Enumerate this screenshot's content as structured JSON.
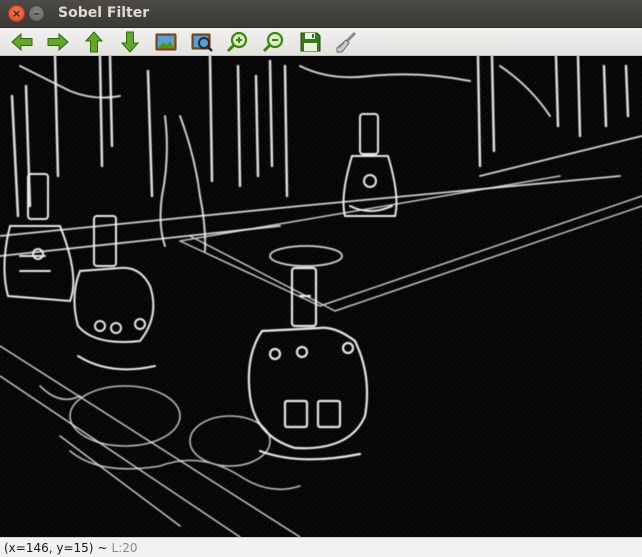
{
  "window": {
    "title": "Sobel Filter",
    "close_glyph": "×",
    "minimize_glyph": "–"
  },
  "toolbar": {
    "items": [
      {
        "name": "pan-left-button",
        "icon": "arrow-left-icon",
        "color": "#4e9a06"
      },
      {
        "name": "pan-right-button",
        "icon": "arrow-right-icon",
        "color": "#4e9a06"
      },
      {
        "name": "pan-up-button",
        "icon": "arrow-up-icon",
        "color": "#4e9a06"
      },
      {
        "name": "pan-down-button",
        "icon": "arrow-down-icon",
        "color": "#4e9a06"
      },
      {
        "name": "zoom-fit-button",
        "icon": "picture-icon"
      },
      {
        "name": "zoom-region-button",
        "icon": "picture-zoom-icon"
      },
      {
        "name": "zoom-in-button",
        "icon": "zoom-in-icon",
        "color": "#4e9a06"
      },
      {
        "name": "zoom-out-button",
        "icon": "zoom-out-icon",
        "color": "#4e9a06"
      },
      {
        "name": "save-button",
        "icon": "floppy-disk-icon",
        "color": "#3a7a16"
      },
      {
        "name": "properties-button",
        "icon": "brush-icon"
      }
    ]
  },
  "status": {
    "coords": "(x=146, y=15)",
    "separator": "~",
    "level": "L:20"
  }
}
